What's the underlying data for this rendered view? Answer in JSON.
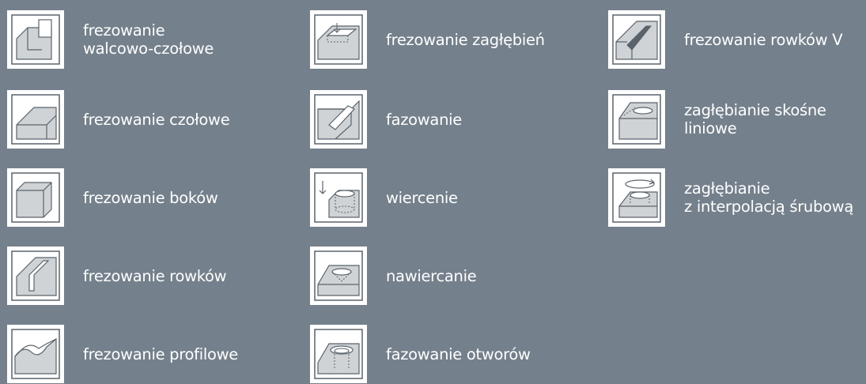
{
  "colors": {
    "background": "#74808b",
    "tile": "#ffffff",
    "face": "#cfd3d6",
    "stroke": "#5a636b",
    "text": "#ffffff"
  },
  "columns": [
    {
      "items": [
        {
          "icon": "shoulder-milling-icon",
          "lines": [
            "frezowanie",
            "walcowo-czołowe"
          ]
        },
        {
          "icon": "face-milling-icon",
          "lines": [
            "frezowanie czołowe"
          ]
        },
        {
          "icon": "side-milling-icon",
          "lines": [
            "frezowanie boków"
          ]
        },
        {
          "icon": "slot-milling-icon",
          "lines": [
            "frezowanie rowków"
          ]
        },
        {
          "icon": "profile-milling-icon",
          "lines": [
            "frezowanie profilowe"
          ]
        }
      ]
    },
    {
      "items": [
        {
          "icon": "pocket-milling-icon",
          "lines": [
            "frezowanie zagłębień"
          ]
        },
        {
          "icon": "chamfering-icon",
          "lines": [
            "fazowanie"
          ]
        },
        {
          "icon": "drilling-icon",
          "lines": [
            "wiercenie"
          ]
        },
        {
          "icon": "spot-drilling-icon",
          "lines": [
            "nawiercanie"
          ]
        },
        {
          "icon": "hole-chamfering-icon",
          "lines": [
            "fazowanie otworów"
          ]
        }
      ]
    },
    {
      "items": [
        {
          "icon": "v-groove-milling-icon",
          "lines": [
            "frezowanie rowków V"
          ]
        },
        {
          "icon": "ramping-icon",
          "lines": [
            "zagłębianie skośne",
            "liniowe"
          ]
        },
        {
          "icon": "helical-interpolation-icon",
          "lines": [
            "zagłębianie",
            "z interpolacją śrubową"
          ]
        }
      ]
    }
  ]
}
